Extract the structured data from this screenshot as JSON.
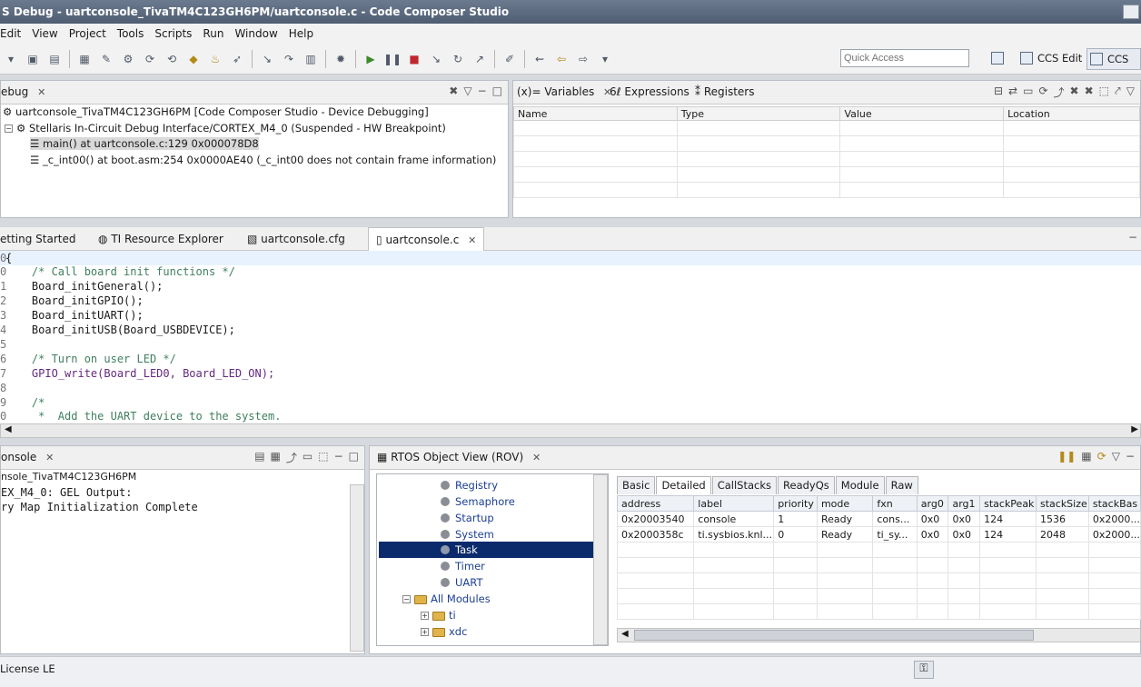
{
  "window": {
    "title": "S Debug - uartconsole_TivaTM4C123GH6PM/uartconsole.c - Code Composer Studio"
  },
  "menu": [
    "Edit",
    "View",
    "Project",
    "Tools",
    "Scripts",
    "Run",
    "Window",
    "Help"
  ],
  "toolbar": {
    "quick_access_placeholder": "Quick Access",
    "perspectives": [
      "CCS Edit",
      "CCS De"
    ]
  },
  "debug_view": {
    "tab_label": "ebug",
    "rows": [
      "uartconsole_TivaTM4C123GH6PM [Code Composer Studio - Device Debugging]",
      "Stellaris In-Circuit Debug Interface/CORTEX_M4_0 (Suspended - HW Breakpoint)",
      "main() at uartconsole.c:129 0x000078D8",
      "_c_int00() at boot.asm:254 0x0000AE40  (_c_int00 does not contain frame information)"
    ]
  },
  "variables_view": {
    "tabs": [
      "Variables",
      "Expressions",
      "Registers"
    ],
    "columns": [
      "Name",
      "Type",
      "Value",
      "Location"
    ]
  },
  "editor": {
    "tabs": [
      "etting Started",
      "TI Resource Explorer",
      "uartconsole.cfg",
      "uartconsole.c"
    ],
    "gutter": [
      "0",
      "0",
      "1",
      "2",
      "3",
      "4",
      "5",
      "6",
      "7",
      "8",
      "9",
      "0"
    ],
    "lines": [
      "{",
      "    /* Call board init functions */",
      "    Board_initGeneral();",
      "    Board_initGPIO();",
      "    Board_initUART();",
      "    Board_initUSB(Board_USBDEVICE);",
      "",
      "    /* Turn on user LED */",
      "    GPIO_write(Board_LED0, Board_LED_ON);",
      "",
      "    /*",
      "     *  Add the UART device to the system."
    ]
  },
  "console": {
    "tab_label": "onsole",
    "subtitle": "nsole_TivaTM4C123GH6PM",
    "lines": [
      "EX_M4_0: GEL Output:",
      "ry Map Initialization Complete"
    ]
  },
  "rov": {
    "tab_label": "RTOS Object View (ROV)",
    "tree_items": [
      "Registry",
      "Semaphore",
      "Startup",
      "System",
      "Task",
      "Timer",
      "UART"
    ],
    "all_modules": "All Modules",
    "subnodes": [
      "ti",
      "xdc"
    ],
    "tabs": [
      "Basic",
      "Detailed",
      "CallStacks",
      "ReadyQs",
      "Module",
      "Raw"
    ],
    "columns": [
      "address",
      "label",
      "priority",
      "mode",
      "fxn",
      "arg0",
      "arg1",
      "stackPeak",
      "stackSize",
      "stackBas"
    ],
    "rows": [
      [
        "0x20003540",
        "console",
        "1",
        "Ready",
        "cons...",
        "0x0",
        "0x0",
        "124",
        "1536",
        "0x2000..."
      ],
      [
        "0x2000358c",
        "ti.sysbios.knl...",
        "0",
        "Ready",
        "ti_sy...",
        "0x0",
        "0x0",
        "124",
        "2048",
        "0x2000..."
      ]
    ]
  },
  "status": {
    "text": "License  LE"
  }
}
